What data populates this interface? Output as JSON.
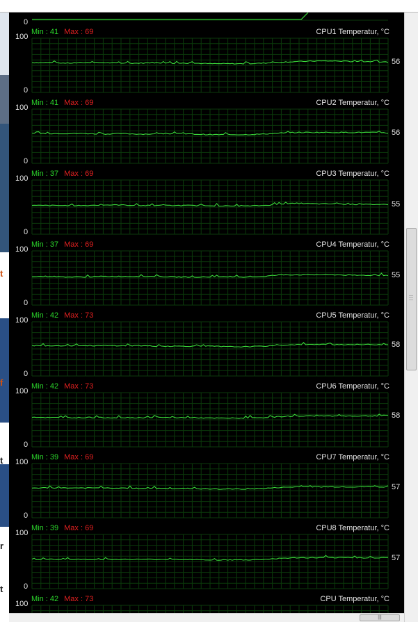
{
  "app": {
    "accent_line": "#3bdc3b",
    "grid_color": "#0b3a0b",
    "bg": "#000000"
  },
  "top_panel": {
    "y_min_label": "0"
  },
  "graphs": [
    {
      "title": "CPU1 Temperatur, °C",
      "min_label": "Min : 41",
      "max_label": "Max : 69",
      "current": "56",
      "y_max": "100",
      "y_min": "0"
    },
    {
      "title": "CPU2 Temperatur, °C",
      "min_label": "Min : 41",
      "max_label": "Max : 69",
      "current": "56",
      "y_max": "100",
      "y_min": "0"
    },
    {
      "title": "CPU3 Temperatur, °C",
      "min_label": "Min : 37",
      "max_label": "Max : 69",
      "current": "55",
      "y_max": "100",
      "y_min": "0"
    },
    {
      "title": "CPU4 Temperatur, °C",
      "min_label": "Min : 37",
      "max_label": "Max : 69",
      "current": "55",
      "y_max": "100",
      "y_min": "0"
    },
    {
      "title": "CPU5 Temperatur, °C",
      "min_label": "Min : 42",
      "max_label": "Max : 73",
      "current": "58",
      "y_max": "100",
      "y_min": "0"
    },
    {
      "title": "CPU6 Temperatur, °C",
      "min_label": "Min : 42",
      "max_label": "Max : 73",
      "current": "58",
      "y_max": "100",
      "y_min": "0"
    },
    {
      "title": "CPU7 Temperatur, °C",
      "min_label": "Min : 39",
      "max_label": "Max : 69",
      "current": "57",
      "y_max": "100",
      "y_min": "0"
    },
    {
      "title": "CPU8 Temperatur, °C",
      "min_label": "Min : 39",
      "max_label": "Max : 69",
      "current": "57",
      "y_max": "100",
      "y_min": "0"
    },
    {
      "title": "CPU Temperatur, °C",
      "min_label": "Min : 42",
      "max_label": "Max : 73",
      "current": "",
      "y_max": "100",
      "y_min": ""
    }
  ],
  "left_strip": {
    "letters": [
      "t",
      "f",
      "t",
      "r",
      "t"
    ]
  },
  "scrollbar": {
    "grip": "|||"
  },
  "chart_data": [
    {
      "type": "line",
      "title": "CPU1 Temperatur, °C",
      "ylim": [
        0,
        100
      ],
      "series": [
        {
          "name": "CPU1 Temperatur, °C",
          "values": [
            55,
            55,
            54,
            55,
            55,
            54,
            54,
            55,
            54,
            54,
            53,
            53,
            53,
            54,
            56,
            57,
            58,
            58,
            57,
            57,
            56
          ],
          "min": 41,
          "max": 69,
          "current": 56
        }
      ]
    },
    {
      "type": "line",
      "title": "CPU2 Temperatur, °C",
      "ylim": [
        0,
        100
      ],
      "series": [
        {
          "name": "CPU2 Temperatur, °C",
          "values": [
            55,
            55,
            55,
            55,
            54,
            55,
            54,
            54,
            55,
            54,
            53,
            53,
            53,
            54,
            56,
            57,
            57,
            57,
            57,
            57,
            56
          ],
          "min": 41,
          "max": 69,
          "current": 56
        }
      ]
    },
    {
      "type": "line",
      "title": "CPU3 Temperatur, °C",
      "ylim": [
        0,
        100
      ],
      "series": [
        {
          "name": "CPU3 Temperatur, °C",
          "values": [
            53,
            53,
            53,
            53,
            54,
            54,
            53,
            53,
            53,
            53,
            53,
            52,
            52,
            53,
            56,
            57,
            56,
            56,
            55,
            55,
            55
          ],
          "min": 37,
          "max": 69,
          "current": 55
        }
      ]
    },
    {
      "type": "line",
      "title": "CPU4 Temperatur, °C",
      "ylim": [
        0,
        100
      ],
      "series": [
        {
          "name": "CPU4 Temperatur, °C",
          "values": [
            53,
            53,
            52,
            52,
            53,
            53,
            53,
            53,
            52,
            52,
            52,
            52,
            52,
            53,
            56,
            56,
            56,
            56,
            55,
            55,
            55
          ],
          "min": 37,
          "max": 69,
          "current": 55
        }
      ]
    },
    {
      "type": "line",
      "title": "CPU5 Temperatur, °C",
      "ylim": [
        0,
        100
      ],
      "series": [
        {
          "name": "CPU5 Temperatur, °C",
          "values": [
            56,
            56,
            56,
            56,
            56,
            56,
            56,
            55,
            55,
            55,
            55,
            54,
            54,
            55,
            57,
            58,
            58,
            58,
            58,
            58,
            58
          ],
          "min": 42,
          "max": 73,
          "current": 58
        }
      ]
    },
    {
      "type": "line",
      "title": "CPU6 Temperatur, °C",
      "ylim": [
        0,
        100
      ],
      "series": [
        {
          "name": "CPU6 Temperatur, °C",
          "values": [
            55,
            54,
            54,
            54,
            54,
            54,
            54,
            54,
            54,
            54,
            53,
            53,
            53,
            54,
            56,
            57,
            57,
            57,
            57,
            57,
            58
          ],
          "min": 42,
          "max": 73,
          "current": 58
        }
      ]
    },
    {
      "type": "line",
      "title": "CPU7 Temperatur, °C",
      "ylim": [
        0,
        100
      ],
      "series": [
        {
          "name": "CPU7 Temperatur, °C",
          "values": [
            55,
            55,
            55,
            55,
            55,
            55,
            54,
            54,
            54,
            54,
            53,
            53,
            53,
            54,
            56,
            57,
            57,
            57,
            57,
            57,
            57
          ],
          "min": 39,
          "max": 69,
          "current": 57
        }
      ]
    },
    {
      "type": "line",
      "title": "CPU8 Temperatur, °C",
      "ylim": [
        0,
        100
      ],
      "series": [
        {
          "name": "CPU8 Temperatur, °C",
          "values": [
            54,
            54,
            54,
            54,
            54,
            54,
            54,
            54,
            54,
            54,
            53,
            53,
            53,
            54,
            56,
            57,
            57,
            57,
            57,
            57,
            57
          ],
          "min": 39,
          "max": 69,
          "current": 57
        }
      ]
    }
  ]
}
